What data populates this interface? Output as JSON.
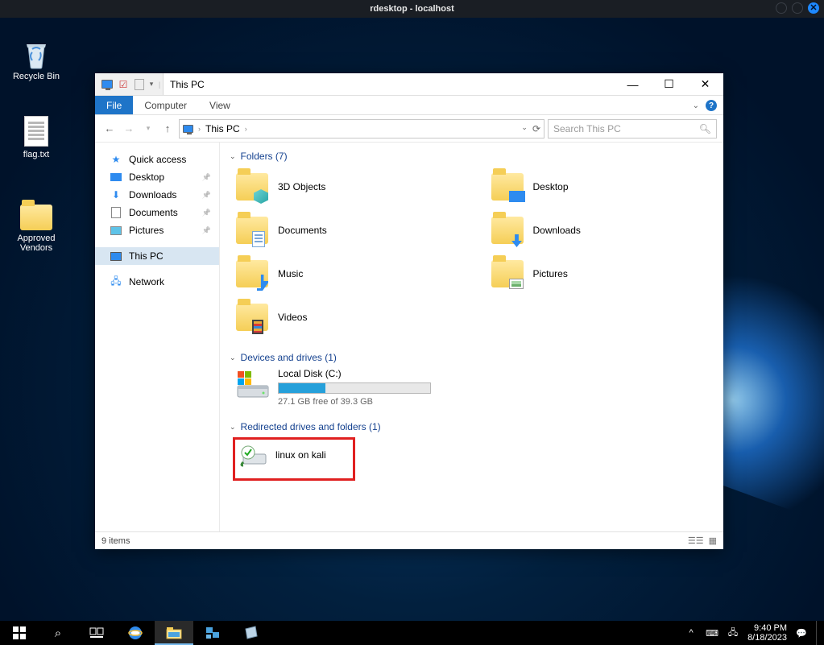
{
  "wm": {
    "title": "rdesktop - localhost"
  },
  "desktop": {
    "recycle": "Recycle Bin",
    "flag": "flag.txt",
    "approved": "Approved Vendors"
  },
  "explorer": {
    "title": "This PC",
    "ribbon": {
      "file": "File",
      "computer": "Computer",
      "view": "View"
    },
    "address": {
      "location": "This PC"
    },
    "search": {
      "placeholder": "Search This PC"
    },
    "sidebar": {
      "quick": "Quick access",
      "desktop": "Desktop",
      "downloads": "Downloads",
      "documents": "Documents",
      "pictures": "Pictures",
      "thispc": "This PC",
      "network": "Network"
    },
    "sections": {
      "folders": "Folders (7)",
      "devices": "Devices and drives (1)",
      "redirected": "Redirected drives and folders (1)"
    },
    "folders": {
      "obj3d": "3D Objects",
      "desktop": "Desktop",
      "documents": "Documents",
      "downloads": "Downloads",
      "music": "Music",
      "pictures": "Pictures",
      "videos": "Videos"
    },
    "drive": {
      "name": "Local Disk (C:)",
      "free_text": "27.1 GB free of 39.3 GB",
      "fill_pct": 31
    },
    "redirected": {
      "name": "linux on kali"
    },
    "status": "9 items"
  },
  "taskbar": {
    "time": "9:40 PM",
    "date": "8/18/2023"
  }
}
